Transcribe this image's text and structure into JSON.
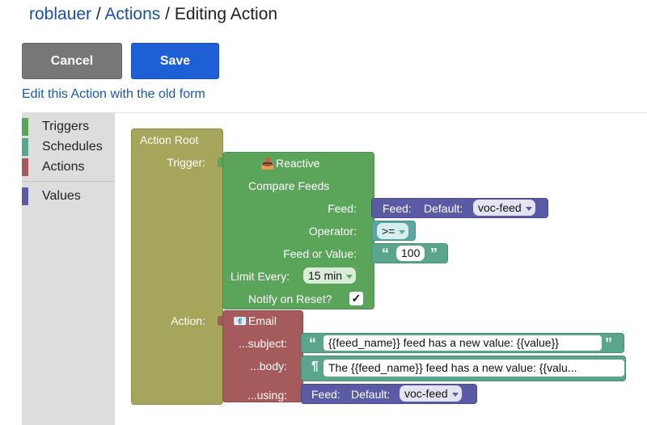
{
  "breadcrumb": {
    "user": "roblauer",
    "sep1": " / ",
    "section": "Actions",
    "sep2": " / ",
    "current": "Editing Action"
  },
  "buttons": {
    "cancel": "Cancel",
    "save": "Save"
  },
  "old_form_link": "Edit this Action with the old form",
  "toolbox": {
    "categories": [
      {
        "label": "Triggers",
        "color": "#5ba55b"
      },
      {
        "label": "Schedules",
        "color": "#5ba58c"
      },
      {
        "label": "Actions",
        "color": "#a55b5b"
      },
      {
        "label": "Values",
        "color": "#5b5ba5"
      }
    ]
  },
  "blocks": {
    "root": {
      "title": "Action Root",
      "trigger_label": "Trigger:",
      "action_label": "Action:",
      "color": "#a5a55b"
    },
    "reactive": {
      "title": "Reactive",
      "subtitle": "Compare Feeds",
      "feed_label": "Feed:",
      "operator_label": "Operator:",
      "feed_or_value_label": "Feed or Value:",
      "limit_label": "Limit Every:",
      "limit_value": "15 min",
      "notify_label": "Notify on Reset?",
      "notify_checked": "✓",
      "color": "#5ba55b",
      "icon": "tray-icon"
    },
    "feed_value": {
      "label": "Feed:",
      "default_label": "Default:",
      "selected": "voc-feed",
      "color": "#5b5ba5"
    },
    "operator_value": {
      "selected": ">=",
      "color": "#5ba5a5"
    },
    "number_value": {
      "value": "100",
      "open_quote": "“",
      "close_quote": "”",
      "color": "#5ba58c"
    },
    "email": {
      "title": "Email",
      "subject_label": "...subject:",
      "body_label": "...body:",
      "using_label": "...using:",
      "color": "#a55b5b",
      "icon": "email-icon"
    },
    "subject_text": {
      "value": "{{feed_name}} feed has a new value: {{value}}",
      "open_quote": "“",
      "close_quote": "”",
      "color": "#5ba58c"
    },
    "body_text": {
      "value": "The {{feed_name}} feed has a new value: {{valu...",
      "pilcrow": "¶",
      "color": "#5ba58c"
    },
    "using_feed": {
      "label": "Feed:",
      "default_label": "Default:",
      "selected": "voc-feed",
      "color": "#5b5ba5"
    }
  }
}
